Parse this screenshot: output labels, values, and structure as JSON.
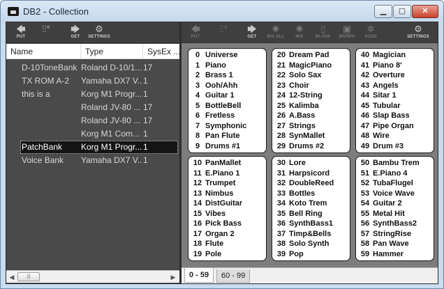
{
  "window": {
    "title": "DB2 - Collection",
    "min_label": "▁",
    "max_label": "▢",
    "close_label": "✕"
  },
  "left_toolbar": [
    {
      "label": "PUT",
      "icon": "arrow-left-icon",
      "glyph": "🡄"
    },
    {
      "label": "",
      "icon": "sliders-icon",
      "glyph": "⫶⫶°"
    },
    {
      "label": "GET",
      "icon": "arrow-right-icon",
      "glyph": "🡆"
    },
    {
      "label": "SETTINGS",
      "icon": "gear-icon",
      "glyph": "⚙"
    }
  ],
  "right_toolbar": [
    {
      "label": "PUT",
      "icon": "arrow-left-icon",
      "glyph": "🡄",
      "enabled": false
    },
    {
      "label": "",
      "icon": "sliders-icon",
      "glyph": "⫶⫶°",
      "enabled": false
    },
    {
      "label": "GET",
      "icon": "arrow-right-icon",
      "glyph": "🡆",
      "enabled": true
    },
    {
      "label": "MIX ALL",
      "icon": "mix-all-icon",
      "glyph": "✺",
      "enabled": false
    },
    {
      "label": "MIX",
      "icon": "mix-icon",
      "glyph": "✺",
      "enabled": false
    },
    {
      "label": "BLANK",
      "icon": "blank-icon",
      "glyph": "▯",
      "enabled": false
    },
    {
      "label": "MORPH",
      "icon": "morph-icon",
      "glyph": "▣",
      "enabled": false
    },
    {
      "label": "4GEN",
      "icon": "generate-icon",
      "glyph": "✲",
      "enabled": false
    },
    {
      "label": "SETTINGS",
      "icon": "gear-icon",
      "glyph": "⚙",
      "enabled": true
    }
  ],
  "list": {
    "headers": [
      "Name",
      "Type",
      "SysEx ..."
    ],
    "rows": [
      {
        "name": "D-10ToneBank",
        "type": "Roland D-10/1...",
        "sysex": "17",
        "selected": false
      },
      {
        "name": "TX ROM A-2",
        "type": "Yamaha DX7 V...",
        "sysex": "1",
        "selected": false
      },
      {
        "name": "this is a",
        "type": "Korg M1 Progr...",
        "sysex": "1",
        "selected": false
      },
      {
        "name": "",
        "type": "Roland JV-80 ...",
        "sysex": "17",
        "selected": false
      },
      {
        "name": "",
        "type": "Roland JV-80 ...",
        "sysex": "17",
        "selected": false
      },
      {
        "name": "",
        "type": "Korg M1 Com...",
        "sysex": "1",
        "selected": false
      },
      {
        "name": "PatchBank",
        "type": "Korg M1 Progr...",
        "sysex": "1",
        "selected": true
      },
      {
        "name": "Voice Bank",
        "type": "Yamaha DX7 V...",
        "sysex": "1",
        "selected": false
      }
    ]
  },
  "scrollbar": {
    "left_arrow": "◀",
    "right_arrow": "▶",
    "thumb_grip": "|||"
  },
  "banks": [
    [
      "Universe",
      "Piano",
      "Brass 1",
      "Ooh/Ahh",
      "Guitar 1",
      "BottleBell",
      "Fretless",
      "Symphonic",
      "Pan Flute",
      "Drums #1"
    ],
    [
      "Dream Pad",
      "MagicPiano",
      "Solo Sax",
      "Choir",
      "12-String",
      "Kalimba",
      "A.Bass",
      "Strings",
      "SynMallet",
      "Drums #2"
    ],
    [
      "Magician",
      "Piano 8'",
      "Overture",
      "Angels",
      "Sitar 1",
      "Tubular",
      "Slap Bass",
      "Pipe Organ",
      "Wire",
      "Drum #3"
    ],
    [
      "PanMallet",
      "E.Piano 1",
      "Trumpet",
      "Nimbus",
      "DistGuitar",
      "Vibes",
      "Pick Bass",
      "Organ 2",
      "Flute",
      "Pole"
    ],
    [
      "Lore",
      "Harpsicord",
      "DoubleReed",
      "Bottles",
      "Koto Trem",
      "Bell Ring",
      "SynthBass1",
      "Timp&Bells",
      "Solo Synth",
      "Pop"
    ],
    [
      "Bambu Trem",
      "E.Piano 4",
      "TubaFlugel",
      "Voice Wave",
      "Guitar 2",
      "Metal Hit",
      "SynthBass2",
      "StringRise",
      "Pan Wave",
      "Hammer"
    ]
  ],
  "bank_start_numbers": [
    0,
    20,
    40,
    10,
    30,
    50
  ],
  "tabs": [
    {
      "label": "0 - 59",
      "active": true
    },
    {
      "label": "60 - 99",
      "active": false
    }
  ]
}
